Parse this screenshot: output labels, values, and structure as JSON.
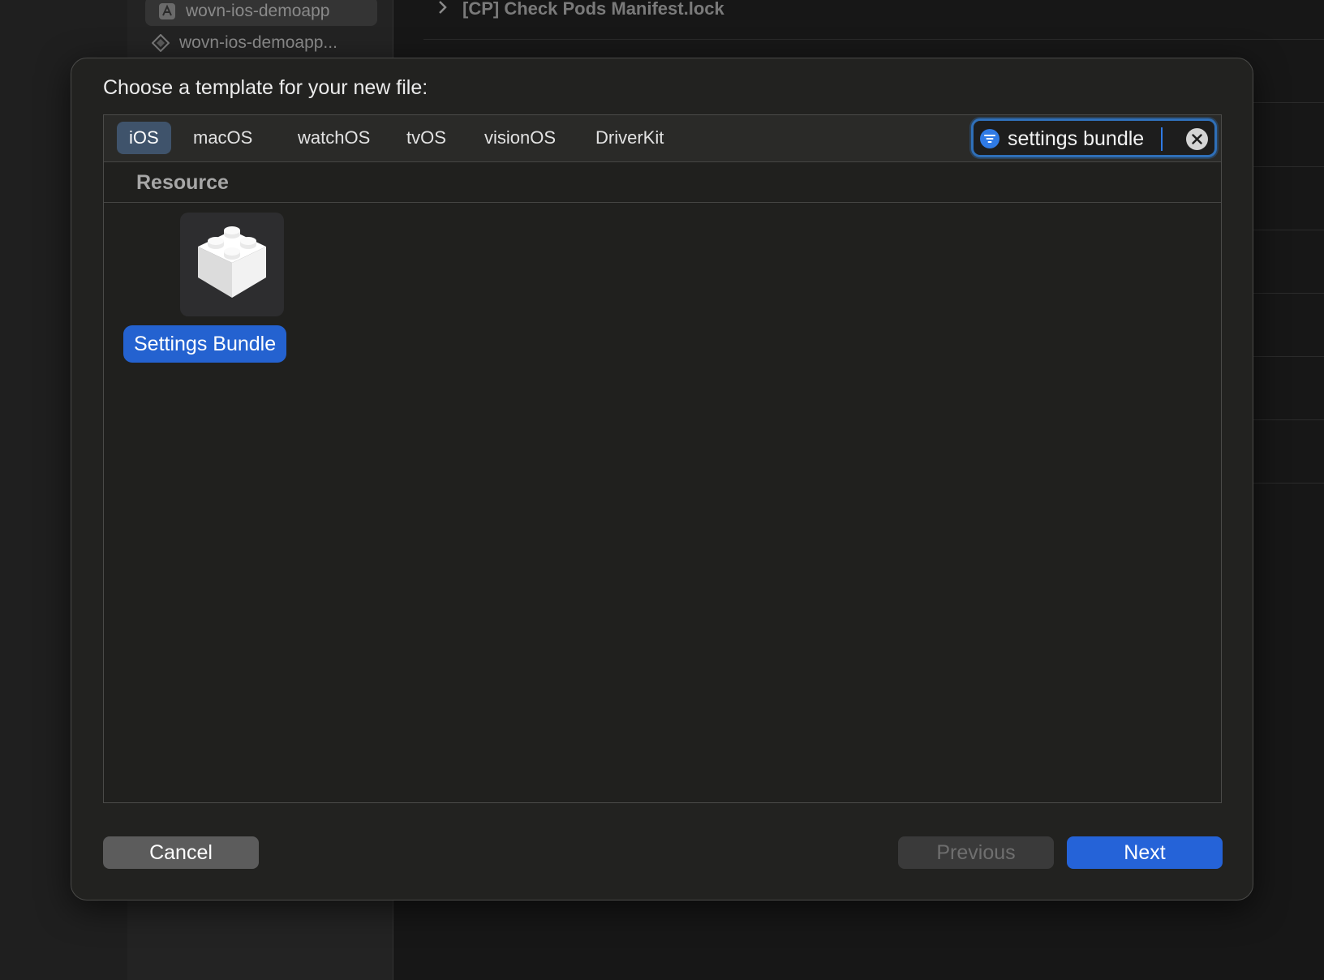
{
  "background": {
    "navigator_items": [
      {
        "label": "wovn-ios-demoapp",
        "icon": "app-target-icon"
      },
      {
        "label": "wovn-ios-demoapp...",
        "icon": "scheme-icon"
      }
    ],
    "build_phase": {
      "label": "[CP] Check Pods Manifest.lock",
      "icon": "chevron-right-icon"
    }
  },
  "dialog": {
    "title": "Choose a template for your new file:",
    "platform_tabs": [
      {
        "label": "iOS",
        "selected": true
      },
      {
        "label": "macOS",
        "selected": false
      },
      {
        "label": "watchOS",
        "selected": false
      },
      {
        "label": "tvOS",
        "selected": false
      },
      {
        "label": "visionOS",
        "selected": false
      },
      {
        "label": "DriverKit",
        "selected": false
      }
    ],
    "search": {
      "value": "settings bundle",
      "filter_icon": "filter-icon",
      "clear_icon": "clear-icon"
    },
    "section_header": "Resource",
    "templates": [
      {
        "label": "Settings Bundle",
        "icon": "lego-brick-icon",
        "selected": true
      }
    ],
    "buttons": {
      "cancel": "Cancel",
      "previous": "Previous",
      "next": "Next"
    }
  },
  "colors": {
    "accent": "#2563d8",
    "selected_tab": "#3f536b",
    "sheet_background": "#222220"
  }
}
